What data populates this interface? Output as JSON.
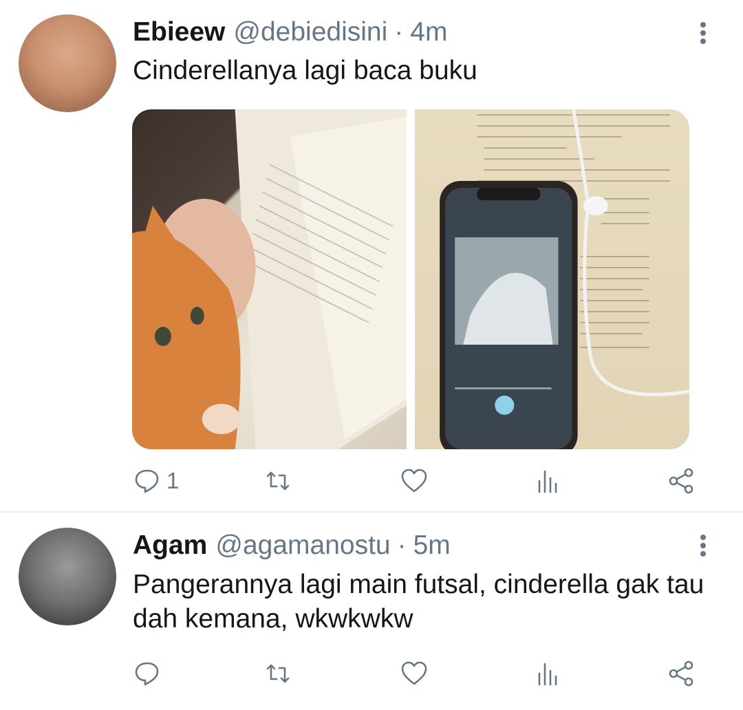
{
  "tweets": [
    {
      "author_name": "Ebieew",
      "handle": "@debiedisini",
      "separator": "·",
      "time": "4m",
      "text": "Cinderellanya lagi baca buku",
      "reply_count": "1"
    },
    {
      "author_name": "Agam",
      "handle": "@agamanostu",
      "separator": "·",
      "time": "5m",
      "text": "Pangerannya lagi main futsal, cinderella gak tau dah kemana, wkwkwkw",
      "reply_count": ""
    }
  ],
  "icons": {
    "reply": "reply-icon",
    "retweet": "retweet-icon",
    "like": "heart-icon",
    "stats": "analytics-icon",
    "share": "share-icon",
    "more": "more-vertical-icon"
  },
  "colors": {
    "text": "#14171a",
    "secondary": "#657786",
    "divider": "#e6ecf0"
  }
}
